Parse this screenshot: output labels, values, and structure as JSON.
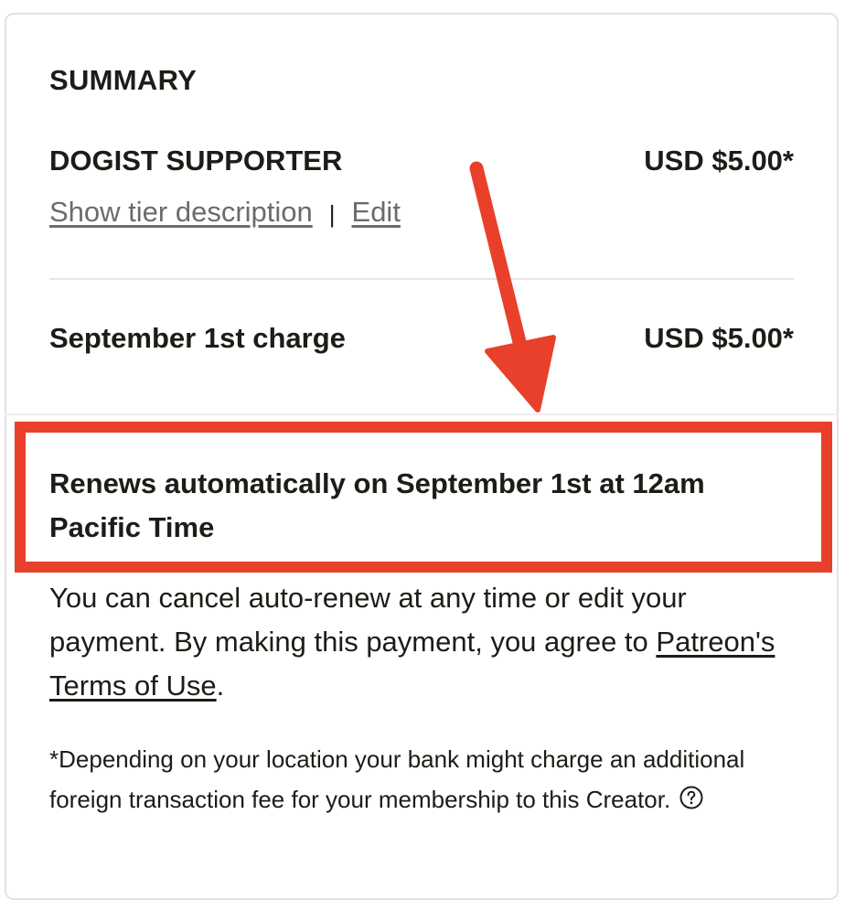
{
  "summary": {
    "title": "SUMMARY"
  },
  "tier": {
    "name": "DOGIST SUPPORTER",
    "price": "USD $5.00*",
    "show_description_label": "Show tier description",
    "separator": "|",
    "edit_label": "Edit"
  },
  "charge": {
    "label": "September 1st charge",
    "price": "USD $5.00*"
  },
  "renewal": {
    "text": "Renews automatically on September 1st at 12am Pacific Time"
  },
  "cancel": {
    "text_before": "You can cancel auto-renew at any time or edit your payment. By making this payment, you agree to ",
    "terms_link": "Patreon's Terms of Use",
    "text_after": "."
  },
  "footnote": {
    "text": "*Depending on your location your bank might charge an additional foreign transaction fee for your membership to this Creator."
  },
  "icons": {
    "help": "help-circle-icon",
    "annotation_arrow": "arrow-down-icon"
  },
  "colors": {
    "highlight": "#e8402a",
    "text": "#1e1c17",
    "muted_link": "#6b6b6b"
  }
}
